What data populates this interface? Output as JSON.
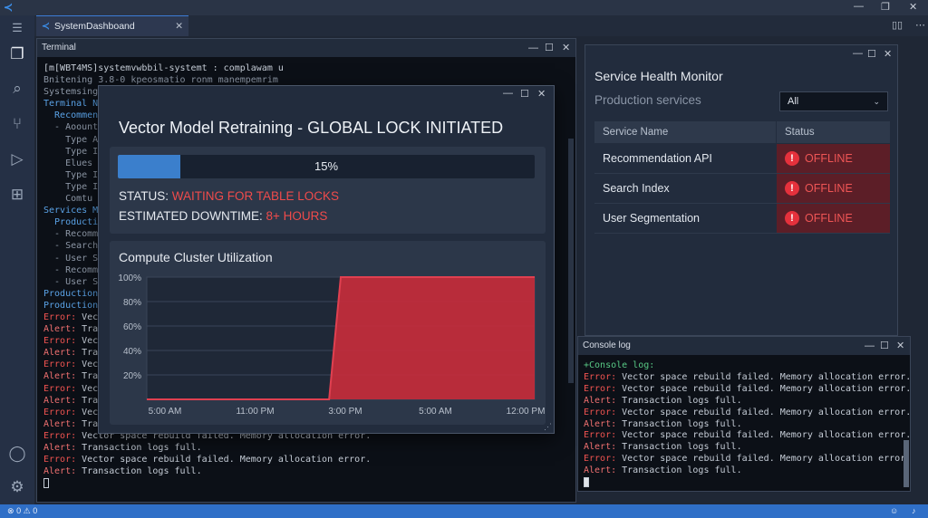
{
  "window": {
    "tab_title": "SystemDashboand"
  },
  "terminal": {
    "title": "Terminal",
    "lines": [
      {
        "text": "[m[WBT4MS]systemvwbbil-systemt : complawam u",
        "cls": ""
      },
      {
        "text": "Bnitening 3.8-0 kpeosmatio ronm manempemrim",
        "cls": "dim"
      },
      {
        "text": "Systemsing",
        "cls": "dim"
      },
      {
        "text": "Terminal N",
        "cls": "blue"
      },
      {
        "text": "  Recommen",
        "cls": "blue"
      },
      {
        "text": "  - Aoount",
        "cls": "dim"
      },
      {
        "text": "    Type A",
        "cls": "dim"
      },
      {
        "text": "    Type I",
        "cls": "dim"
      },
      {
        "text": "    Elues",
        "cls": "dim"
      },
      {
        "text": "    Type I",
        "cls": "dim"
      },
      {
        "text": "    Type I",
        "cls": "dim"
      },
      {
        "text": "    Comtu",
        "cls": "dim"
      },
      {
        "text": "Services M",
        "cls": "blue"
      },
      {
        "text": "  Producti",
        "cls": "blue"
      },
      {
        "text": "  - Recomm",
        "cls": "dim"
      },
      {
        "text": "  - Search",
        "cls": "dim"
      },
      {
        "text": "  - User S",
        "cls": "dim"
      },
      {
        "text": "  - Recomm",
        "cls": "dim"
      },
      {
        "text": "  - User S",
        "cls": "dim"
      },
      {
        "text": "Production",
        "cls": "blue"
      },
      {
        "text": "Production",
        "cls": "blue"
      }
    ],
    "log": [
      {
        "label": "Error:",
        "type": "err",
        "msg": " Vect"
      },
      {
        "label": "Alert:",
        "type": "alert",
        "msg": " Tran"
      },
      {
        "label": "Error:",
        "type": "err",
        "msg": " Vect"
      },
      {
        "label": "Alert:",
        "type": "alert",
        "msg": " Tran"
      },
      {
        "label": "Error:",
        "type": "err",
        "msg": " Vect"
      },
      {
        "label": "Alert:",
        "type": "alert",
        "msg": " Tran"
      },
      {
        "label": "Error:",
        "type": "err",
        "msg": " Vect"
      },
      {
        "label": "Alert:",
        "type": "alert",
        "msg": " Tran"
      },
      {
        "label": "Error:",
        "type": "err",
        "msg": " Vect"
      },
      {
        "label": "Alert:",
        "type": "alert",
        "msg": " Tran"
      },
      {
        "label": "Error:",
        "type": "err",
        "msg": " Vector space rebuild failed. Memory allocation error."
      },
      {
        "label": "Alert:",
        "type": "alert",
        "msg": " Transaction logs full."
      },
      {
        "label": "Error:",
        "type": "err",
        "msg": " Vector space rebuild failed. Memory allocation error."
      },
      {
        "label": "Alert:",
        "type": "alert",
        "msg": " Transaction logs full."
      }
    ]
  },
  "modal": {
    "title": "Vector Model Retraining - GLOBAL LOCK INITIATED",
    "progress": {
      "value": 15,
      "label": "15%"
    },
    "status_label": "STATUS: ",
    "status_value": "WAITING FOR TABLE LOCKS",
    "downtime_label": "ESTIMATED DOWNTIME: ",
    "downtime_value": "8+ HOURS"
  },
  "chart_data": {
    "type": "area",
    "title": "Compute Cluster Utilization",
    "xlabel": "",
    "ylabel": "",
    "x_ticks": [
      "5:00 AM",
      "11:00 PM",
      "3:00 PM",
      "5:00 AM",
      "12:00 PM"
    ],
    "y_ticks": [
      "100%",
      "80%",
      "60%",
      "40%",
      "20%"
    ],
    "ylim": [
      0,
      100
    ],
    "x": [
      0,
      0.47,
      0.5,
      1.0
    ],
    "values": [
      0,
      0,
      100,
      100
    ],
    "fill_color": "#c62d3b",
    "grid": true
  },
  "health": {
    "title": "Service Health Monitor",
    "subtitle": "Production services",
    "filter": "All",
    "columns": [
      "Service Name",
      "Status"
    ],
    "rows": [
      {
        "name": "Recommendation API",
        "status": "OFFLINE"
      },
      {
        "name": "Search Index",
        "status": "OFFLINE"
      },
      {
        "name": "User Segmentation",
        "status": "OFFLINE"
      }
    ]
  },
  "console": {
    "title": "Console log",
    "heading": "+Console log:",
    "lines": [
      {
        "label": "Error:",
        "type": "err",
        "msg": " Vector space rebuild failed. Memory allocation error."
      },
      {
        "label": "Error:",
        "type": "err",
        "msg": " Vector space rebuild failed. Memory allocation error."
      },
      {
        "label": "Alert:",
        "type": "alert",
        "msg": " Transaction logs full."
      },
      {
        "label": "Error:",
        "type": "err",
        "msg": " Vector space rebuild failed. Memory allocation error."
      },
      {
        "label": "Alert:",
        "type": "alert",
        "msg": " Transaction logs full."
      },
      {
        "label": "Error:",
        "type": "err",
        "msg": " Vector space rebuild failed. Memory allocation error."
      },
      {
        "label": "Alert:",
        "type": "alert",
        "msg": " Transaction logs full."
      },
      {
        "label": "Error:",
        "type": "err",
        "msg": " Vector space rebuild failed. Memory allocation error."
      },
      {
        "label": "Alert:",
        "type": "alert",
        "msg": " Transaction logs full."
      }
    ]
  },
  "statusbar": {
    "errors": "0",
    "warnings": "0"
  },
  "colors": {
    "accent": "#3b7fcc",
    "offline": "#ef5555",
    "statusbar": "#2f6fc7"
  }
}
